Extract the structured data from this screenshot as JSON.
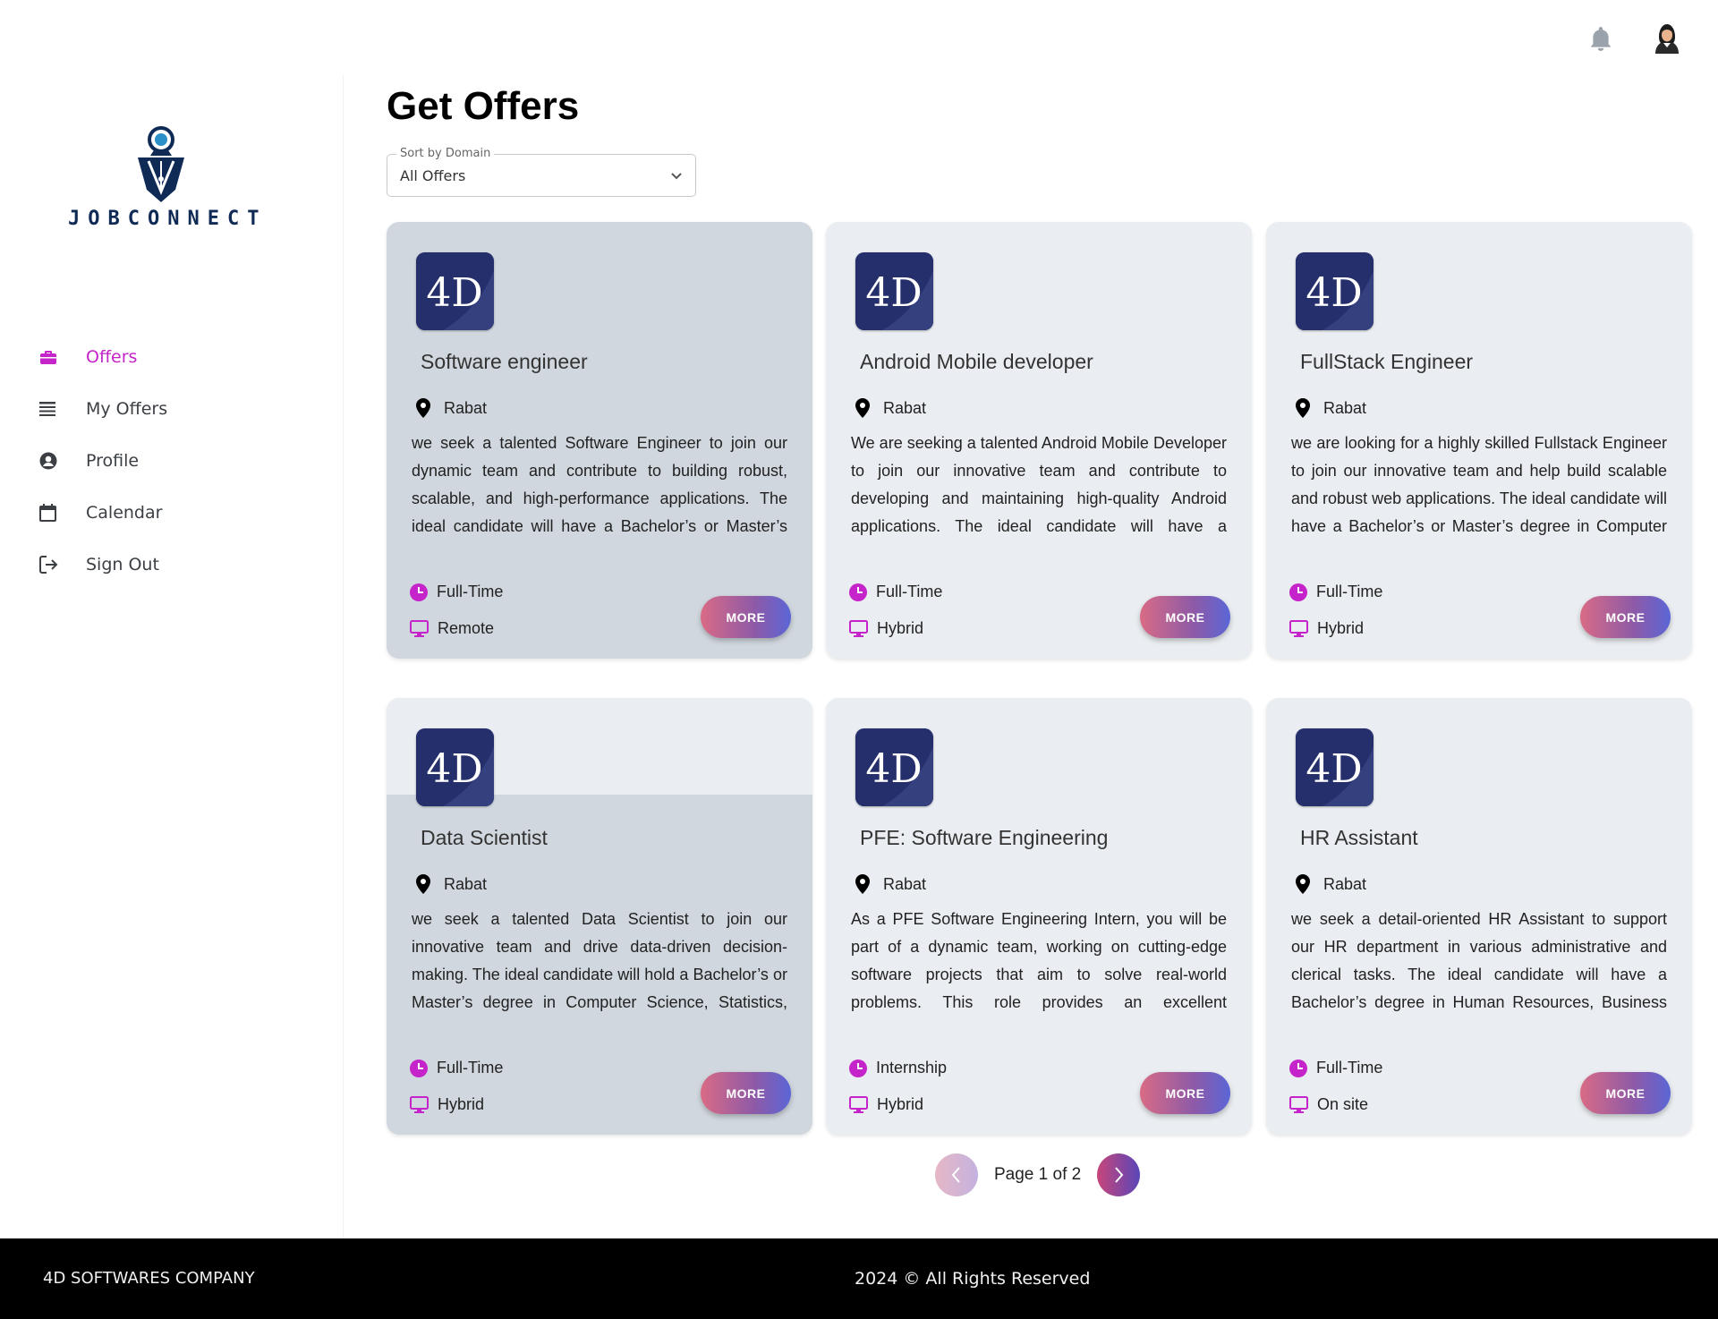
{
  "header": {
    "notification_icon": "bell-icon",
    "avatar_icon": "user-avatar"
  },
  "sidebar": {
    "brand": "JOBCONNECT",
    "items": [
      {
        "label": "Offers",
        "icon": "briefcase-icon",
        "active": true
      },
      {
        "label": "My Offers",
        "icon": "list-icon",
        "active": false
      },
      {
        "label": "Profile",
        "icon": "user-circle-icon",
        "active": false
      },
      {
        "label": "Calendar",
        "icon": "calendar-icon",
        "active": false
      },
      {
        "label": "Sign Out",
        "icon": "sign-out-icon",
        "active": false
      }
    ]
  },
  "main": {
    "title": "Get Offers",
    "sort": {
      "label": "Sort by Domain",
      "value": "All Offers"
    },
    "offers": [
      {
        "company_logo": "4D",
        "title": "Software engineer",
        "location": "Rabat",
        "description": "we seek a talented Software Engineer to join our dynamic team and contribute to building robust, scalable, and high-performance applications. The ideal candidate will have a Bachelor’s or Master’s degree in Computer Scien…",
        "type": "Full-Time",
        "mode": "Remote",
        "more": "MORE"
      },
      {
        "company_logo": "4D",
        "title": "Android Mobile developer",
        "location": "Rabat",
        "description": "We are seeking a talented Android Mobile Developer to join our innovative team and contribute to developing and maintaining high-quality Android applications. The ideal candidate will have a Bachelor’s or Master’s degree…",
        "type": "Full-Time",
        "mode": "Hybrid",
        "more": "MORE"
      },
      {
        "company_logo": "4D",
        "title": "FullStack Engineer",
        "location": "Rabat",
        "description": "we are looking for a highly skilled Fullstack Engineer to join our innovative team and help build scalable and robust web applications. The ideal candidate will have a Bachelor’s or Master’s degree in Computer Scien…",
        "type": "Full-Time",
        "mode": "Hybrid",
        "more": "MORE"
      },
      {
        "company_logo": "4D",
        "title": "Data Scientist",
        "location": "Rabat",
        "description": "we seek a talented Data Scientist to join our innovative team and drive data-driven decision-making. The ideal candidate will hold a Bachelor’s or Master’s degree in Computer Science, Statistics, Mathematics, Data Scien…",
        "type": "Full-Time",
        "mode": "Hybrid",
        "more": "MORE"
      },
      {
        "company_logo": "4D",
        "title": "PFE: Software Engineering",
        "location": "Rabat",
        "description": "As a PFE Software Engineering Intern, you will be part of a dynamic team, working on cutting-edge software projects that aim to solve real-world problems. This role provides an excellent opportunity to apply your academic knowledge…",
        "type": "Internship",
        "mode": "Hybrid",
        "more": "MORE"
      },
      {
        "company_logo": "4D",
        "title": "HR Assistant",
        "location": "Rabat",
        "description": "we seek a detail-oriented HR Assistant to support our HR department in various administrative and clerical tasks. The ideal candidate will have a Bachelor’s degree in Human Resources, Business Administration, o…",
        "type": "Full-Time",
        "mode": "On site",
        "more": "MORE"
      }
    ],
    "pagination": {
      "text": "Page 1 of 2"
    }
  },
  "footer": {
    "company": "4D SOFTWARES COMPANY",
    "copyright": "2024 © All Rights Reserved"
  },
  "colors": {
    "accent": "#c424c9",
    "card_bg": "#eaedf1",
    "card_hover_bg": "#d0d7de",
    "logo_navy": "#0f2a55"
  }
}
